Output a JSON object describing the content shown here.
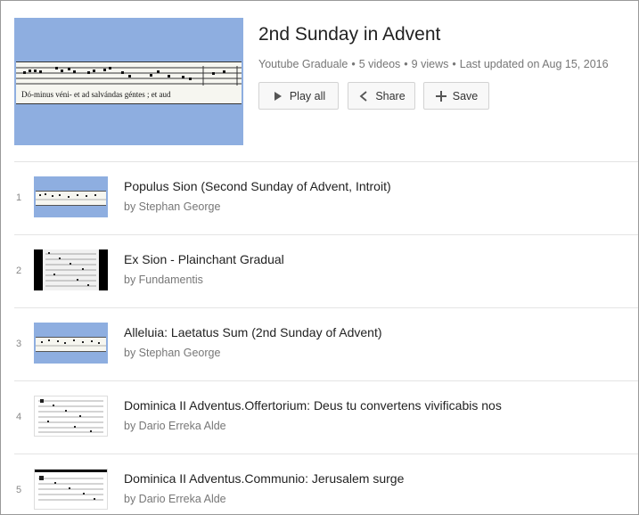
{
  "playlist": {
    "title": "2nd Sunday in Advent",
    "header_lyric": "Dó-minus véni-   et   ad   salvándas   géntes ;   et aud",
    "meta": {
      "channel": "Youtube Graduale",
      "videos": "5 videos",
      "views": "9 views",
      "updated": "Last updated on Aug 15, 2016",
      "separator": "•"
    },
    "actions": {
      "play_all": "Play all",
      "share": "Share",
      "save": "Save"
    }
  },
  "videos": [
    {
      "index": "1",
      "title": "Populus Sion (Second Sunday of Advent, Introit)",
      "by": "by Stephan George",
      "thumb": "blue-chant-strip"
    },
    {
      "index": "2",
      "title": "Ex Sion - Plainchant Gradual",
      "by": "by Fundamentis",
      "thumb": "dark-chant-page"
    },
    {
      "index": "3",
      "title": "Alleluia: Laetatus Sum (2nd Sunday of Advent)",
      "by": "by Stephan George",
      "thumb": "blue-chant-strip"
    },
    {
      "index": "4",
      "title": "Dominica II Adventus.Offertorium: Deus tu convertens vivificabis nos",
      "by": "by Dario Erreka Alde",
      "thumb": "white-chant-page"
    },
    {
      "index": "5",
      "title": "Dominica II Adventus.Communio: Jerusalem surge",
      "by": "by Dario Erreka Alde",
      "thumb": "white-chant-page"
    }
  ],
  "icons": {
    "play": "play-icon",
    "share": "share-icon",
    "save": "plus-icon"
  }
}
